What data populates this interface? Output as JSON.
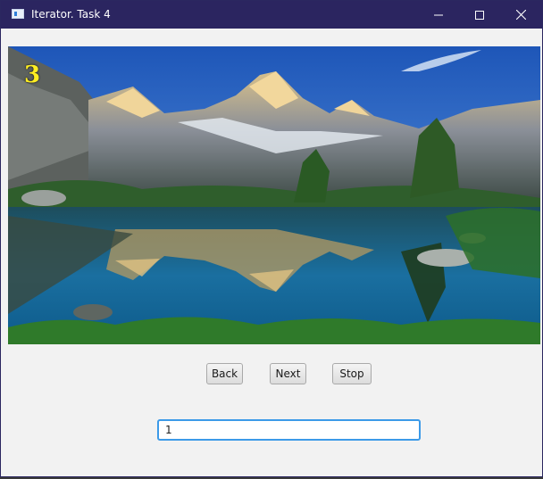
{
  "window": {
    "title": "Iterator. Task 4",
    "controls": {
      "minimize": "minimize-icon",
      "maximize": "maximize-icon",
      "close": "close-icon"
    }
  },
  "slideshow": {
    "counter": "3",
    "image_subject": "mountain lake landscape"
  },
  "controls": {
    "back_label": "Back",
    "next_label": "Next",
    "stop_label": "Stop"
  },
  "input": {
    "value": "1"
  },
  "colors": {
    "titlebar": "#2b2560",
    "counter_text": "#ffee22",
    "input_focus": "#3c9ae8"
  }
}
